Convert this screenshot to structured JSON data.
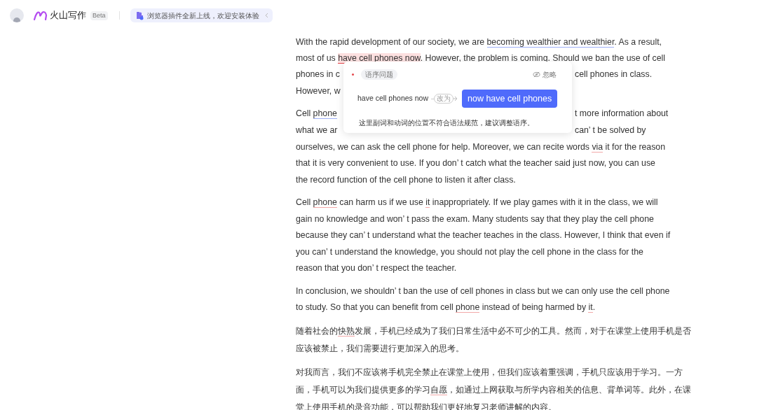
{
  "header": {
    "logo_text": "火山写作",
    "badge": "Beta",
    "notice": "浏览器插件全新上线，欢迎安装体验"
  },
  "document": {
    "paragraphs": [
      {
        "kind": "english",
        "lines": [
          {
            "segments": [
              {
                "text": "With the rapid development of our society, we are "
              },
              {
                "text": "becoming wealthier and wealthier",
                "kind": "style"
              },
              {
                "text": ". As a result,"
              }
            ]
          },
          {
            "segments": [
              {
                "text": "most of us "
              },
              {
                "text": "have cell phones now",
                "kind": "active"
              },
              {
                "text": ". However, the problem is coming. Should we ban the use of cell"
              }
            ]
          },
          {
            "segments": [
              {
                "text": "phones in c"
              }
            ],
            "right": [
              {
                "text": "cell phones in class."
              }
            ]
          },
          {
            "segments": [
              {
                "text": "However, w"
              }
            ]
          }
        ]
      },
      {
        "kind": "english",
        "lines": [
          {
            "segments": [
              {
                "text": "Cell "
              },
              {
                "text": "phone",
                "kind": "style"
              }
            ],
            "right": [
              {
                "text": "t more information about"
              }
            ]
          },
          {
            "segments": [
              {
                "text": "what we ar"
              }
            ],
            "right": [
              {
                "text": "can’ t be solved by"
              }
            ]
          },
          {
            "segments": [
              {
                "text": "ourselves, we can ask the cell phone for help. Moreover, we can recite words "
              },
              {
                "text": "via",
                "kind": "spelling"
              },
              {
                "text": " it for the reason"
              }
            ]
          },
          {
            "segments": [
              {
                "text": "that it is very convenient to use. If you don’ t catch what the teacher said just now, you can use"
              }
            ]
          },
          {
            "segments": [
              {
                "text": "the record function of the cell phone to listen it after class."
              }
            ]
          }
        ]
      },
      {
        "kind": "english",
        "lines": [
          {
            "segments": [
              {
                "text": "Cell "
              },
              {
                "text": "phone",
                "kind": "spelling"
              },
              {
                "text": " can harm us if we use "
              },
              {
                "text": "it",
                "kind": "spelling"
              },
              {
                "text": " inappropriately. If we play games with it in the class, we will"
              }
            ]
          },
          {
            "segments": [
              {
                "text": "gain no knowledge and won’ t pass the exam. Many students say that they play the cell phone"
              }
            ]
          },
          {
            "segments": [
              {
                "text": "because they can’ t understand what the teacher teaches in the class. However, I think that even if"
              }
            ]
          },
          {
            "segments": [
              {
                "text": "you can’ t understand the knowledge, you should not play the cell phone in the class for the"
              }
            ]
          },
          {
            "segments": [
              {
                "text": "reason that you don’ t respect the teacher."
              }
            ]
          }
        ]
      },
      {
        "kind": "english",
        "lines": [
          {
            "segments": [
              {
                "text": "In conclusion, we shouldn’ t ban the use of cell phones in class but we can only use the cell phone"
              }
            ]
          },
          {
            "segments": [
              {
                "text": "to study. So that you can benefit from cell "
              },
              {
                "text": "phone",
                "kind": "spelling"
              },
              {
                "text": " instead of being harmed by "
              },
              {
                "text": "it",
                "kind": "spelling"
              },
              {
                "text": "."
              }
            ]
          }
        ]
      },
      {
        "kind": "chinese",
        "lines": [
          {
            "segments": [
              {
                "text": "随着社会的"
              },
              {
                "text": "快熟",
                "kind": "spelling"
              },
              {
                "text": "发展，手机已经成为了我们日常生活中必不可少的工具。然而，对于在课堂上使用手机是否"
              }
            ]
          },
          {
            "segments": [
              {
                "text": "应该被禁止，我们需要进行更加深入的思考。"
              }
            ]
          }
        ]
      },
      {
        "kind": "chinese",
        "lines": [
          {
            "segments": [
              {
                "text": "对我而言，我们不应该将手机完全禁止在课堂上使用，但我们应该着重强调，手机只应该用于学习。一方"
              }
            ]
          },
          {
            "segments": [
              {
                "text": "面，手机可以为我们提供更多的学习"
              },
              {
                "text": "自愿",
                "kind": "spelling"
              },
              {
                "text": "，如通过上网获取与所学内容相关的信息、背单词等。此外，在课"
              }
            ]
          },
          {
            "segments": [
              {
                "text": "堂上使用手机的录音功能，可以帮助我们更好地复习老师讲解的内容。"
              }
            ]
          }
        ]
      }
    ]
  },
  "suggestion": {
    "category": "语序问题",
    "ignore": "忽略",
    "original": "have cell phones now",
    "arrow_label": "改为",
    "replacement": "now have cell phones",
    "explanation": "这里副词和动词的位置不符合语法规范，建议调整语序。"
  }
}
